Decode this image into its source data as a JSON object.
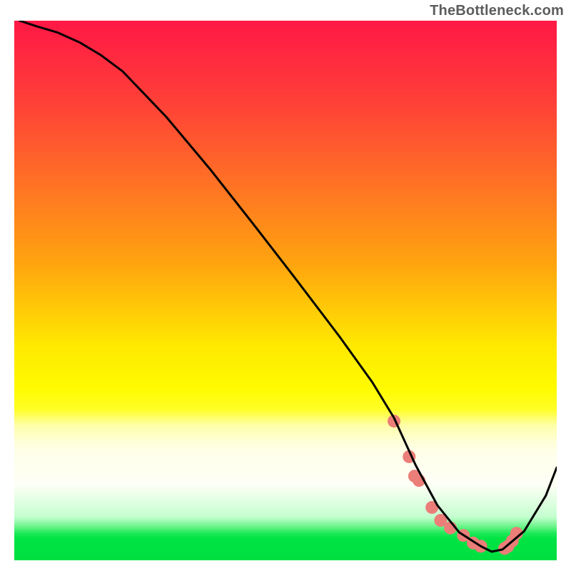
{
  "watermark": "TheBottleneck.com",
  "chart_data": {
    "type": "line",
    "title": "",
    "xlabel": "",
    "ylabel": "",
    "xlim": [
      0,
      100
    ],
    "ylim": [
      0,
      100
    ],
    "grid": false,
    "legend": false,
    "gradient_bands": [
      {
        "y": 0,
        "color": "#ff1846"
      },
      {
        "y": 15,
        "color": "#ff4038"
      },
      {
        "y": 30,
        "color": "#ff7125"
      },
      {
        "y": 45,
        "color": "#ffa40f"
      },
      {
        "y": 60,
        "color": "#ffe801"
      },
      {
        "y": 68,
        "color": "#fffb00"
      },
      {
        "y": 72,
        "color": "#fffe26"
      },
      {
        "y": 75,
        "color": "#feffa8"
      },
      {
        "y": 78,
        "color": "#feffd8"
      },
      {
        "y": 80,
        "color": "#feffe9"
      },
      {
        "y": 86,
        "color": "#fefff6"
      },
      {
        "y": 92,
        "color": "#c4ffcf"
      },
      {
        "y": 94,
        "color": "#5ef280"
      },
      {
        "y": 95,
        "color": "#1be956"
      },
      {
        "y": 96,
        "color": "#01e343"
      },
      {
        "y": 100,
        "color": "#01df41"
      }
    ],
    "series": [
      {
        "name": "curve",
        "color": "#000000",
        "x": [
          1,
          4,
          8,
          12,
          16,
          20,
          28,
          36,
          44,
          52,
          60,
          66,
          70,
          74,
          78,
          82,
          86,
          88,
          90,
          94,
          98,
          100
        ],
        "y": [
          100,
          99,
          97.8,
          96,
          93.6,
          90.6,
          82.2,
          72.6,
          62.4,
          52,
          41.4,
          33,
          26.4,
          17.6,
          10.2,
          5.2,
          2.6,
          1.6,
          2,
          5.4,
          12,
          17.2
        ]
      }
    ],
    "markers": {
      "name": "cluster",
      "color": "#eb7e78",
      "radius_px": 9,
      "x": [
        70,
        72.8,
        73.8,
        74.6,
        77,
        78.6,
        80.4,
        82.8,
        84.6,
        86,
        90.4,
        91,
        91.8,
        92.6
      ],
      "y": [
        25.8,
        19.2,
        15.6,
        14.8,
        9.8,
        7.4,
        6,
        4.6,
        3.2,
        2.6,
        2.2,
        2.6,
        3.6,
        5
      ]
    }
  }
}
